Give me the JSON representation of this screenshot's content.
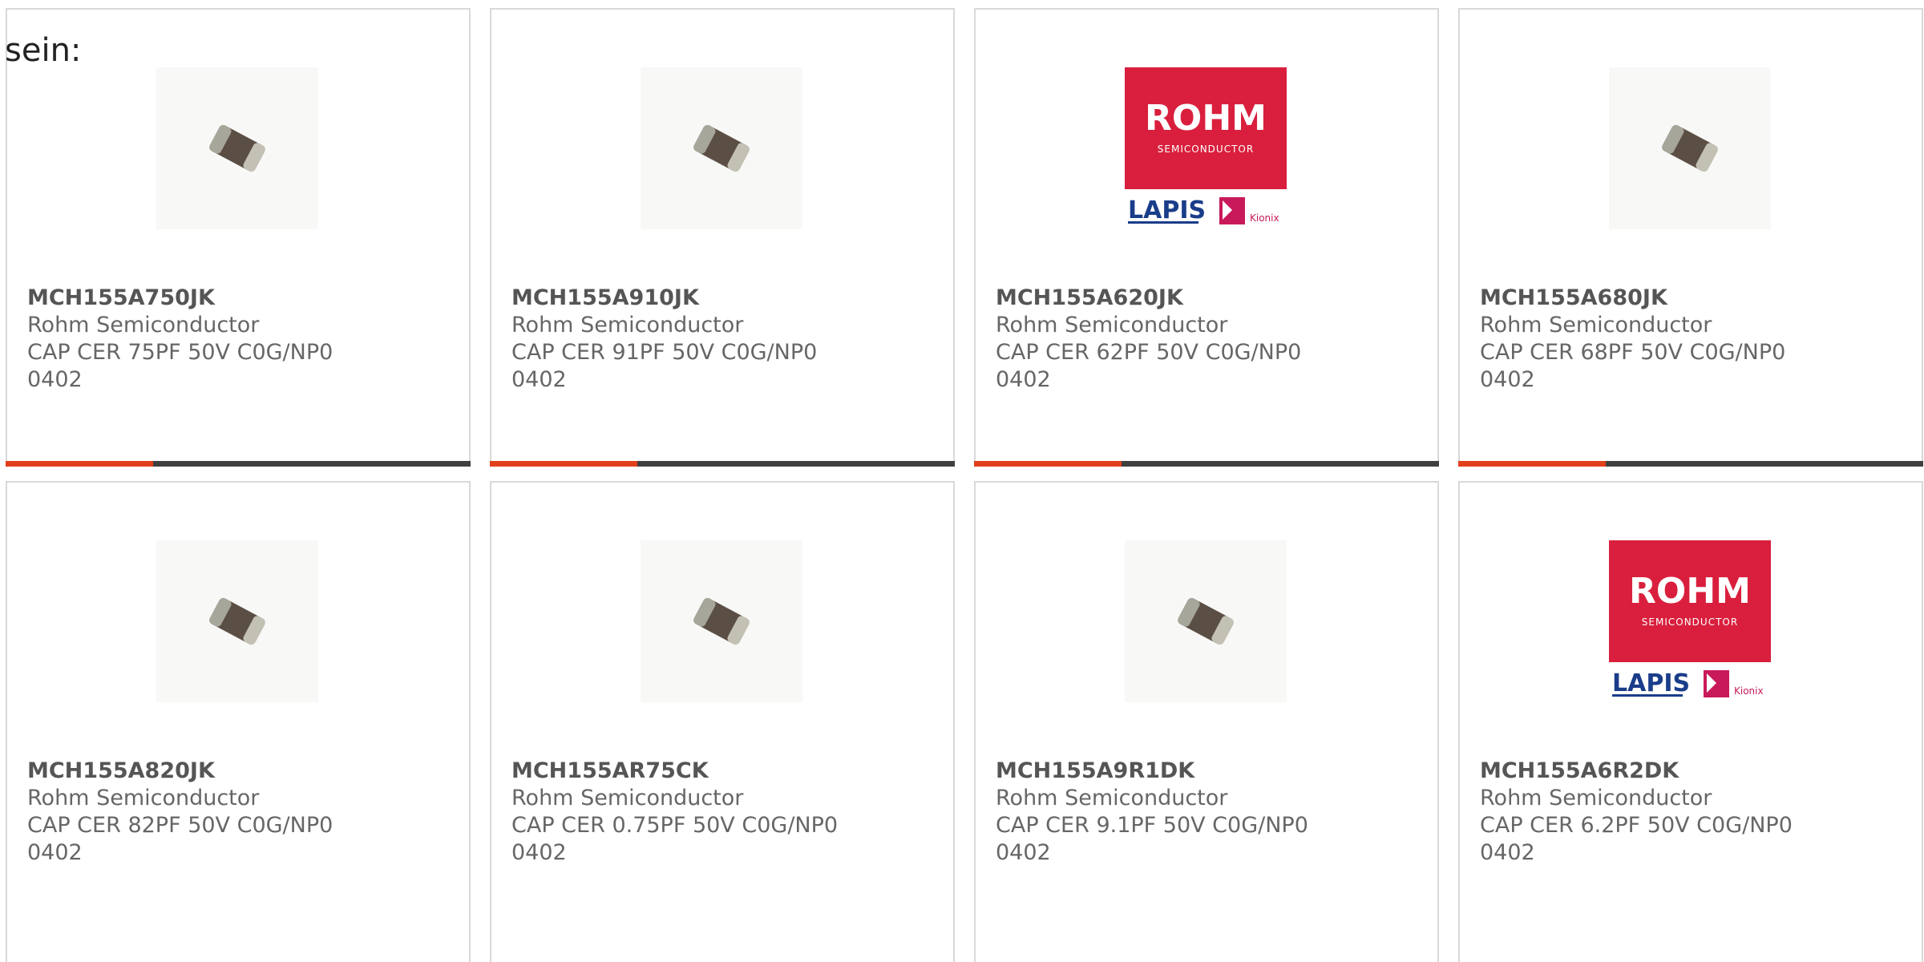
{
  "page": {
    "label": "sein:"
  },
  "colors": {
    "accent": "#e2401b",
    "bar": "#3f3f3f",
    "border": "#d9d9d9",
    "rohm_red": "#d91f3d"
  },
  "products": [
    {
      "part_number": "MCH155A750JK",
      "manufacturer": "Rohm Semiconductor",
      "description": "CAP CER 75PF 50V C0G/NP0 0402",
      "image": "capacitor-chip-icon"
    },
    {
      "part_number": "MCH155A910JK",
      "manufacturer": "Rohm Semiconductor",
      "description": "CAP CER 91PF 50V C0G/NP0 0402",
      "image": "capacitor-chip-icon"
    },
    {
      "part_number": "MCH155A620JK",
      "manufacturer": "Rohm Semiconductor",
      "description": "CAP CER 62PF 50V C0G/NP0 0402",
      "image": "rohm-logo"
    },
    {
      "part_number": "MCH155A680JK",
      "manufacturer": "Rohm Semiconductor",
      "description": "CAP CER 68PF 50V C0G/NP0 0402",
      "image": "capacitor-chip-icon"
    },
    {
      "part_number": "MCH155A820JK",
      "manufacturer": "Rohm Semiconductor",
      "description": "CAP CER 82PF 50V C0G/NP0 0402",
      "image": "capacitor-chip-icon"
    },
    {
      "part_number": "MCH155AR75CK",
      "manufacturer": "Rohm Semiconductor",
      "description": "CAP CER 0.75PF 50V C0G/NP0 0402",
      "image": "capacitor-chip-icon"
    },
    {
      "part_number": "MCH155A9R1DK",
      "manufacturer": "Rohm Semiconductor",
      "description": "CAP CER 9.1PF 50V C0G/NP0 0402",
      "image": "capacitor-chip-icon"
    },
    {
      "part_number": "MCH155A6R2DK",
      "manufacturer": "Rohm Semiconductor",
      "description": "CAP CER 6.2PF 50V C0G/NP0 0402",
      "image": "rohm-logo"
    }
  ]
}
